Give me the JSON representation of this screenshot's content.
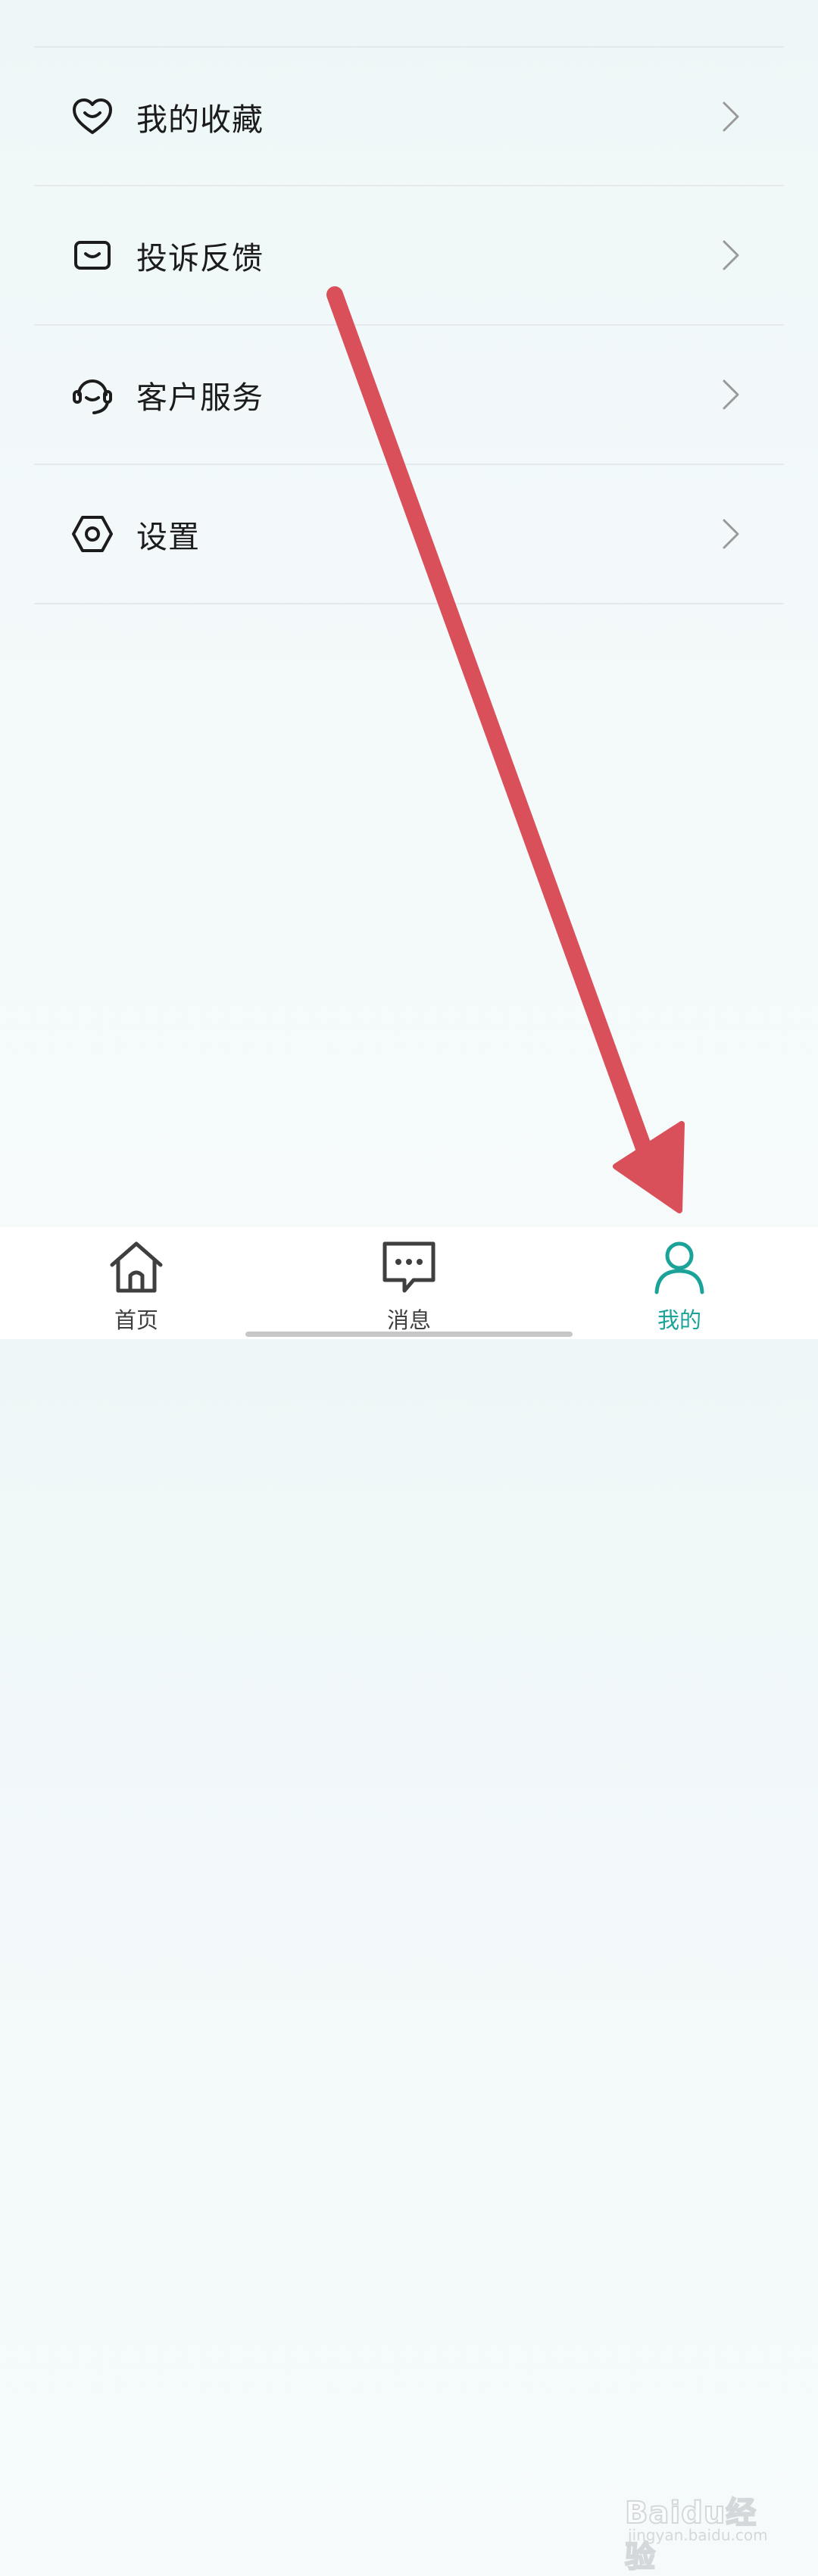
{
  "menu": {
    "items": [
      {
        "label": "我的收藏",
        "icon": "heart-icon"
      },
      {
        "label": "投诉反馈",
        "icon": "feedback-icon"
      },
      {
        "label": "客户服务",
        "icon": "headset-icon"
      },
      {
        "label": "设置",
        "icon": "settings-icon"
      }
    ]
  },
  "tabbar": {
    "tabs": [
      {
        "label": "首页",
        "icon": "home-icon",
        "active": false
      },
      {
        "label": "消息",
        "icon": "message-icon",
        "active": false
      },
      {
        "label": "我的",
        "icon": "profile-icon",
        "active": true
      }
    ]
  },
  "annotation": {
    "icon": "red-arrow-icon",
    "color": "#d9505a"
  },
  "watermark": {
    "text": "Baidu经验",
    "sub": "jingyan.baidu.com"
  },
  "colors": {
    "accent": "#1ba39a",
    "text": "#1c1c1c",
    "arrow": "#d9505a"
  }
}
